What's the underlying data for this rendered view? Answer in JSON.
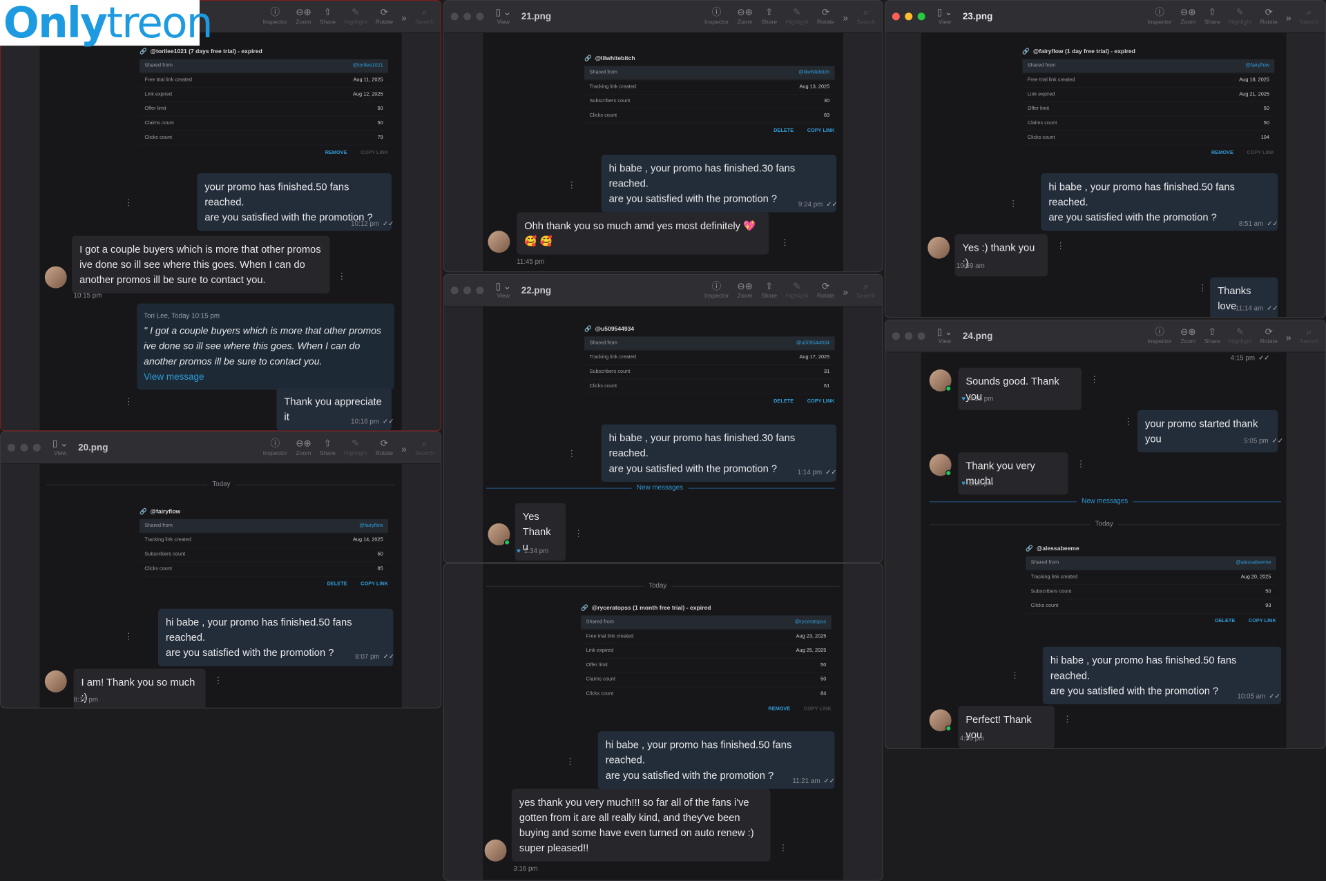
{
  "watermark": {
    "brand_part1": "Only",
    "brand_part2": "treon"
  },
  "toolbar": {
    "view": "View",
    "inspector": "Inspector",
    "zoom": "Zoom",
    "share": "Share",
    "highlight": "Highlight",
    "rotate": "Rotate",
    "search": "Search",
    "sidebar_icon": "▯",
    "chevron": "⌄",
    "info_icon": "ⓘ",
    "zoom_out_icon": "⊖",
    "zoom_in_icon": "⊕",
    "share_icon": "⇧",
    "highlight_icon": "✎",
    "rotate_icon": "⟳",
    "more_icon": "»",
    "search_icon": "⌕"
  },
  "card_labels": {
    "shared_from": "Shared from",
    "free_trial_link_created": "Free trial link created",
    "tracking_link_created": "Tracking link created",
    "link_expired": "Link expired",
    "offer_limit": "Offer limit",
    "claims_count": "Claims count",
    "clicks_count": "Clicks count",
    "subscribers_count": "Subscribers count",
    "remove": "REMOVE",
    "copy_link": "COPY LINK",
    "delete": "DELETE",
    "link_icon": "🔗"
  },
  "common": {
    "today": "Today",
    "new_messages": "New messages",
    "kebab": "⋮",
    "check": "✓✓",
    "heart": "♥",
    "promo_50": "hi babe , your promo has finished.50 fans reached.",
    "promo_30": "hi babe , your promo has finished.30 fans reached.",
    "promo_q": "are you satisfied with the promotion ?"
  },
  "w1": {
    "title": "",
    "card": {
      "header": "@torilee1021 (7 days free trial) - expired",
      "shared_from": "@torilee1021",
      "created": "Aug 11, 2025",
      "expired": "Aug 12, 2025",
      "offer_limit": "50",
      "claims": "50",
      "clicks": "79"
    },
    "m1_line1": "your promo has finished.50 fans reached.",
    "m1_line2": "are you satisfied with the promotion ?",
    "m1_time": "10:12 pm",
    "m2": "I got a couple buyers which is more that other promos ive done so ill see where this goes. When I can do another promos ill be sure to contact you.",
    "m2_time": "10:15 pm",
    "quote_head": "Tori Lee, Today 10:15 pm",
    "quote_text": "\" I got a couple buyers which is more that other promos ive done so ill see where this goes. When I can do another promos ill be sure to contact you.",
    "quote_link": "View message",
    "m3": "Thank you appreciate it",
    "m3_time": "10:16 pm"
  },
  "w20": {
    "title": "20.png",
    "card": {
      "header": "@fairyflow",
      "shared_from": "@fairyflow",
      "created": "Aug 14, 2025",
      "subs": "50",
      "clicks": "85"
    },
    "m1_time": "8:07 pm",
    "m2": "I am! Thank you so much :)",
    "m2_time": "8:16 pm"
  },
  "w21": {
    "title": "21.png",
    "card": {
      "header": "@lilwhitebitch",
      "shared_from": "@lilwhitebitch",
      "created": "Aug 13, 2025",
      "subs": "30",
      "clicks": "83"
    },
    "m1_time": "9:24 pm",
    "m2": "Ohh thank you so much amd yes most definitely 💖 🥰 🥰",
    "m2_time": "11:45 pm"
  },
  "w22": {
    "title": "22.png",
    "card": {
      "header": "@u509544934",
      "shared_from": "@u509544934",
      "created": "Aug 17, 2025",
      "subs": "31",
      "clicks": "61"
    },
    "m1_time": "1:14 pm",
    "m2_line1": "Yes",
    "m2_line2": "Thank u",
    "m2_time": "1:34 pm"
  },
  "w7": {
    "title": "",
    "card": {
      "header": "@ryceratopss (1 month free trial) - expired",
      "shared_from": "@ryceratopss",
      "created": "Aug 23, 2025",
      "expired": "Aug 25, 2025",
      "offer_limit": "50",
      "claims": "50",
      "clicks": "84"
    },
    "m1_time": "11:21 am",
    "m2": "yes thank you very much!!! so far all of the fans i've gotten from it are all really kind, and they've been buying and some have even turned on auto renew :) super pleased!!",
    "m2_time": "3:16 pm"
  },
  "w23": {
    "title": "23.png",
    "card": {
      "header": "@fairyflow (1 day free trial) - expired",
      "shared_from": "@fairyflow",
      "created": "Aug 18, 2025",
      "expired": "Aug 21, 2025",
      "offer_limit": "50",
      "claims": "50",
      "clicks": "104"
    },
    "m1_time": "8:51 am",
    "m2": "Yes :) thank you :)",
    "m2_time": "10:59 am",
    "m3": "Thanks love",
    "m3_time": "11:14 am"
  },
  "w24": {
    "title": "24.png",
    "top_time": "4:15 pm",
    "m1": "Sounds good. Thank you",
    "m1_time": "4:15 pm",
    "m2": "your promo started thank you",
    "m2_time": "5:05 pm",
    "m3": "Thank you very much!",
    "m3_time": "5:28 pm",
    "card": {
      "header": "@alessabeeme",
      "shared_from": "@alessabeeme",
      "created": "Aug 20, 2025",
      "subs": "50",
      "clicks": "93"
    },
    "m4_time": "10:05 am",
    "m5": "Perfect! Thank you",
    "m5_time": "4:58 pm"
  }
}
